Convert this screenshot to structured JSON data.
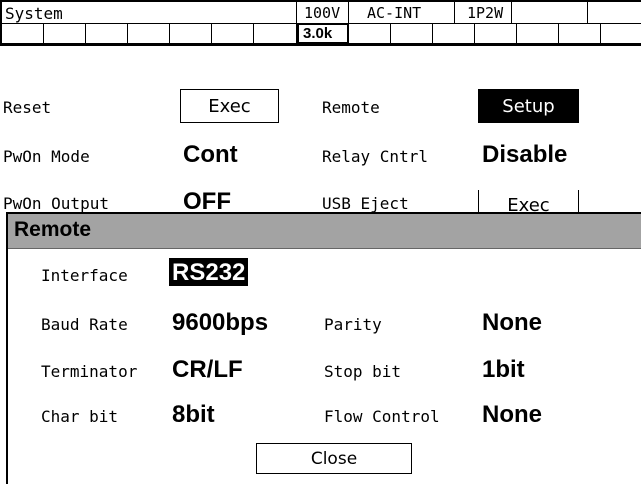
{
  "header": {
    "title": "System",
    "voltage": "100V",
    "source": "AC-INT",
    "wiring": "1P2W",
    "frequency": "3.0k"
  },
  "system": {
    "reset_label": "Reset",
    "reset_button": "Exec",
    "remote_label": "Remote",
    "remote_button": "Setup",
    "pwon_mode_label": "PwOn Mode",
    "pwon_mode_value": "Cont",
    "relay_label": "Relay Cntrl",
    "relay_value": "Disable",
    "pwon_output_label": "PwOn Output",
    "pwon_output_value": "OFF",
    "usb_eject_label": "USB Eject",
    "usb_eject_button": "Exec"
  },
  "remote_dialog": {
    "title": "Remote",
    "interface_label": "Interface",
    "interface_value": "RS232",
    "baud_label": "Baud Rate",
    "baud_value": "9600bps",
    "parity_label": "Parity",
    "parity_value": "None",
    "terminator_label": "Terminator",
    "terminator_value": "CR/LF",
    "stopbit_label": "Stop bit",
    "stopbit_value": "1bit",
    "charbit_label": "Char bit",
    "charbit_value": "8bit",
    "flow_label": "Flow Control",
    "flow_value": "None",
    "close_button": "Close"
  }
}
